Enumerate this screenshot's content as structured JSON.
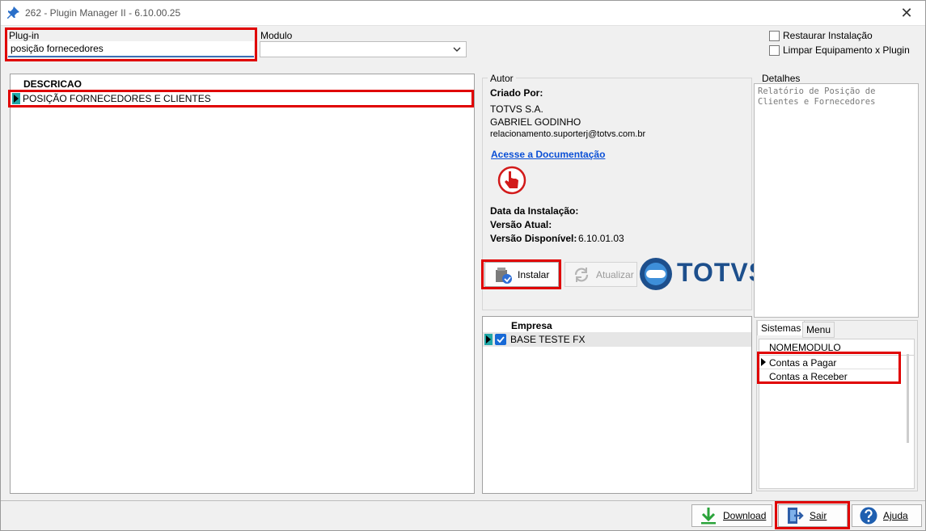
{
  "window": {
    "title": "262 - Plugin Manager II - 6.10.00.25",
    "close_glyph": "✕"
  },
  "filters": {
    "plugin_label": "Plug-in",
    "plugin_value": "posição fornecedores",
    "modulo_label": "Modulo",
    "modulo_value": "",
    "restaurar_label": "Restaurar Instalação",
    "limpar_label": "Limpar Equipamento x Plugin"
  },
  "plugin_grid": {
    "header": "DESCRICAO",
    "rows": [
      "POSIÇÃO FORNECEDORES E CLIENTES"
    ]
  },
  "autor": {
    "group_title": "Autor",
    "criado_por_label": "Criado Por:",
    "line1": "TOTVS S.A.",
    "line2": "GABRIEL GODINHO",
    "line3": "relacionamento.suporterj@totvs.com.br",
    "doc_link": "Acesse a Documentação",
    "data_instalacao_label": "Data da Instalação:",
    "versao_atual_label": "Versão Atual:",
    "versao_disponivel_label": "Versão Disponível:",
    "versao_disponivel_value": "6.10.01.03"
  },
  "actions": {
    "instalar_label": "Instalar",
    "atualizar_label": "Atualizar",
    "brand": "TOTVS"
  },
  "empresa_grid": {
    "header": "Empresa",
    "rows": [
      "BASE TESTE FX"
    ]
  },
  "detalhes": {
    "group_title": "Detalhes",
    "text": "Relatório de Posição de Clientes e Fornecedores"
  },
  "tabs": {
    "sistemas": "Sistemas",
    "menu": "Menu"
  },
  "modulos_grid": {
    "header": "NOMEMODULO",
    "rows": [
      "Contas a Pagar",
      "Contas a Receber"
    ]
  },
  "footer": {
    "download_label": "Download",
    "sair_label": "Sair",
    "ajuda_label": "Ajuda"
  },
  "colors": {
    "highlight_red": "#e00000",
    "link_blue": "#0a4fd6",
    "indicator_teal": "#1fa7a7",
    "brand_blue": "#1d4f8c"
  }
}
